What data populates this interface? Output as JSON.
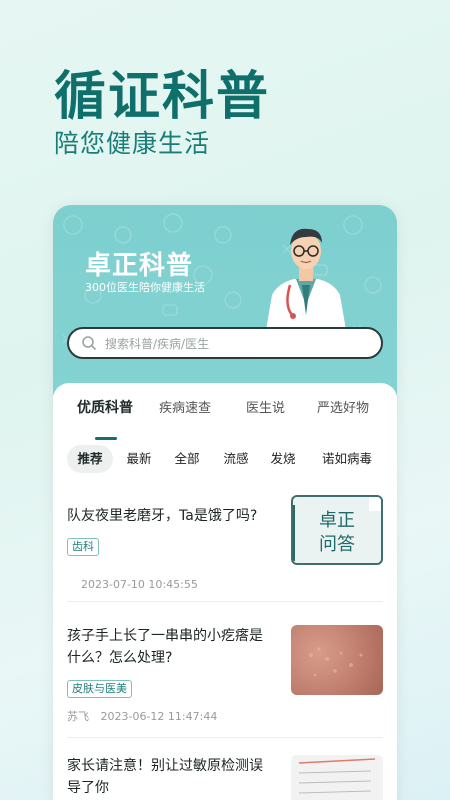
{
  "hero": {
    "title": "循证科普",
    "subtitle": "陪您健康生活"
  },
  "banner": {
    "brand_title": "卓正科普",
    "brand_subtitle": "300位医生陪你健康生活"
  },
  "search": {
    "placeholder": "搜索科普/疾病/医生"
  },
  "tabs": [
    {
      "label": "优质科普",
      "active": true
    },
    {
      "label": "疾病速查",
      "active": false
    },
    {
      "label": "医生说",
      "active": false
    },
    {
      "label": "严选好物",
      "active": false
    }
  ],
  "filters": [
    {
      "label": "推荐",
      "active": true
    },
    {
      "label": "最新"
    },
    {
      "label": "全部"
    },
    {
      "label": "流感"
    },
    {
      "label": "发烧"
    },
    {
      "label": "诺如病毒"
    }
  ],
  "articles": [
    {
      "title": "队友夜里老磨牙，Ta是饿了吗?",
      "tag": "齿科",
      "author": "",
      "date": "2023-07-10 10:45:55",
      "thumb_text_line1": "卓正",
      "thumb_text_line2": "问答"
    },
    {
      "title_line1": "孩子手上长了一串串的小疙瘩是",
      "title_line2": "什么？怎么处理?",
      "tag": "皮肤与医美",
      "author": "苏飞",
      "date": "2023-06-12 11:47:44"
    },
    {
      "title_line1": "家长请注意！别让过敏原检测误",
      "title_line2": "导了你"
    }
  ],
  "colors": {
    "accent": "#11716c",
    "banner": "#7dd0cf",
    "hero_text": "#0f6f6b"
  }
}
